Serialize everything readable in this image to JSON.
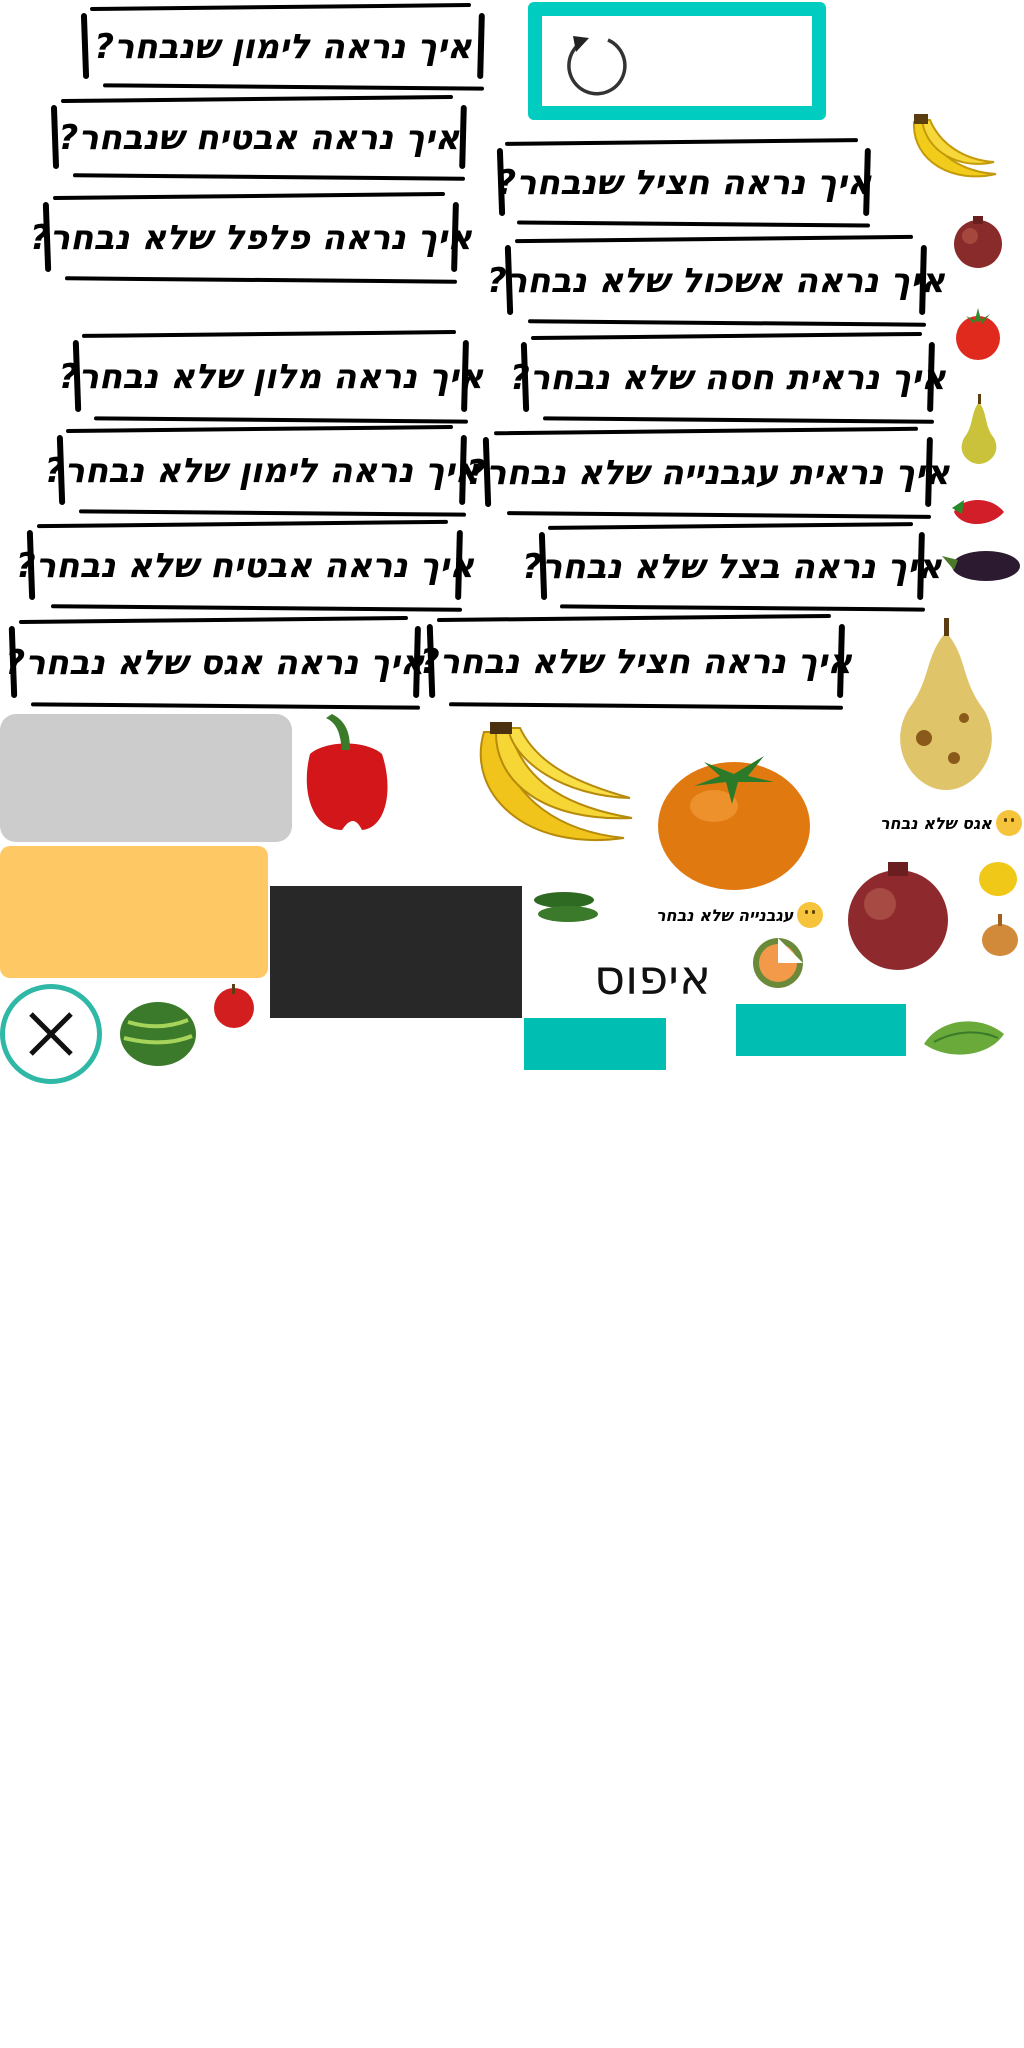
{
  "questions": {
    "q1": "איך נראה לימון שנבחר?",
    "q2": "איך נראה אבטיח שנבחר?",
    "q3": "איך נראה פלפל שלא נבחר?",
    "q4": "איך נראה חציל שנבחר?",
    "q5": "איך נראה אשכול שלא נבחר?",
    "q6": "איך נראה מלון שלא נבחר?",
    "q7": "איך נראית חסה שלא נבחר?",
    "q8": "איך נראה לימון שלא נבחר?",
    "q9": "איך נראית עגבנייה שלא נבחר?",
    "q10": "איך נראה אבטיח שלא נבחר?",
    "q11": "איך נראה בצל שלא נבחר?",
    "q12": "איך נראה אגס שלא נבחר?",
    "q13": "איך נראה חציל שלא נבחר?"
  },
  "labels": {
    "pear_not_chosen": "אגס שלא נבחר",
    "tomato_not_chosen": "עגבנייה שלא נבחר",
    "reset_title": "איפוס"
  },
  "icons": {
    "reset": "reset-icon",
    "close": "close-icon"
  },
  "colors": {
    "teal": "#00cdbf",
    "teal_dark": "#00bfb2",
    "gray_panel": "#cccccc",
    "yellow_panel": "#fec964",
    "dark_panel": "#282828",
    "close_ring": "#2fb8a6"
  }
}
